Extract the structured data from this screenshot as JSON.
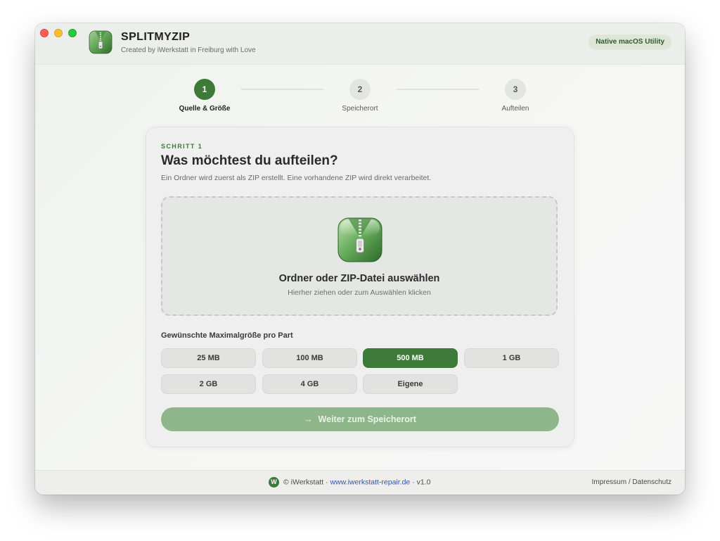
{
  "window": {
    "app_title": "SPLITMYZIP",
    "app_subtitle": "Created by iWerkstatt in Freiburg with Love",
    "badge": "Native macOS Utility"
  },
  "stepper": {
    "steps": [
      {
        "number": "1",
        "label": "Quelle & Größe",
        "active": true
      },
      {
        "number": "2",
        "label": "Speicherort",
        "active": false
      },
      {
        "number": "3",
        "label": "Aufteilen",
        "active": false
      }
    ]
  },
  "card": {
    "kicker": "SCHRITT 1",
    "title": "Was möchtest du aufteilen?",
    "description": "Ein Ordner wird zuerst als ZIP erstellt. Eine vorhandene ZIP wird direkt verarbeitet.",
    "dropzone": {
      "title": "Ordner oder ZIP-Datei auswählen",
      "hint": "Hierher ziehen oder zum Auswählen klicken",
      "icon": "zip-archive-icon"
    },
    "size_label": "Gewünschte Maximalgröße pro Part",
    "sizes": [
      {
        "label": "25 MB",
        "selected": false
      },
      {
        "label": "100 MB",
        "selected": false
      },
      {
        "label": "500 MB",
        "selected": true
      },
      {
        "label": "1 GB",
        "selected": false
      },
      {
        "label": "2 GB",
        "selected": false
      },
      {
        "label": "4 GB",
        "selected": false
      },
      {
        "label": "Eigene",
        "selected": false
      }
    ],
    "continue_label": "Weiter zum Speicherort",
    "continue_icon": "arrow-right-icon"
  },
  "footer": {
    "logo_letter": "W",
    "copyright": "© iWerkstatt ·",
    "link": "www.iwerkstatt-repair.de",
    "version": "· v1.0",
    "legal": "Impressum / Datenschutz"
  },
  "colors": {
    "accent": "#3e7a37",
    "accent_disabled": "#8fb58a",
    "link": "#2a55b8"
  }
}
